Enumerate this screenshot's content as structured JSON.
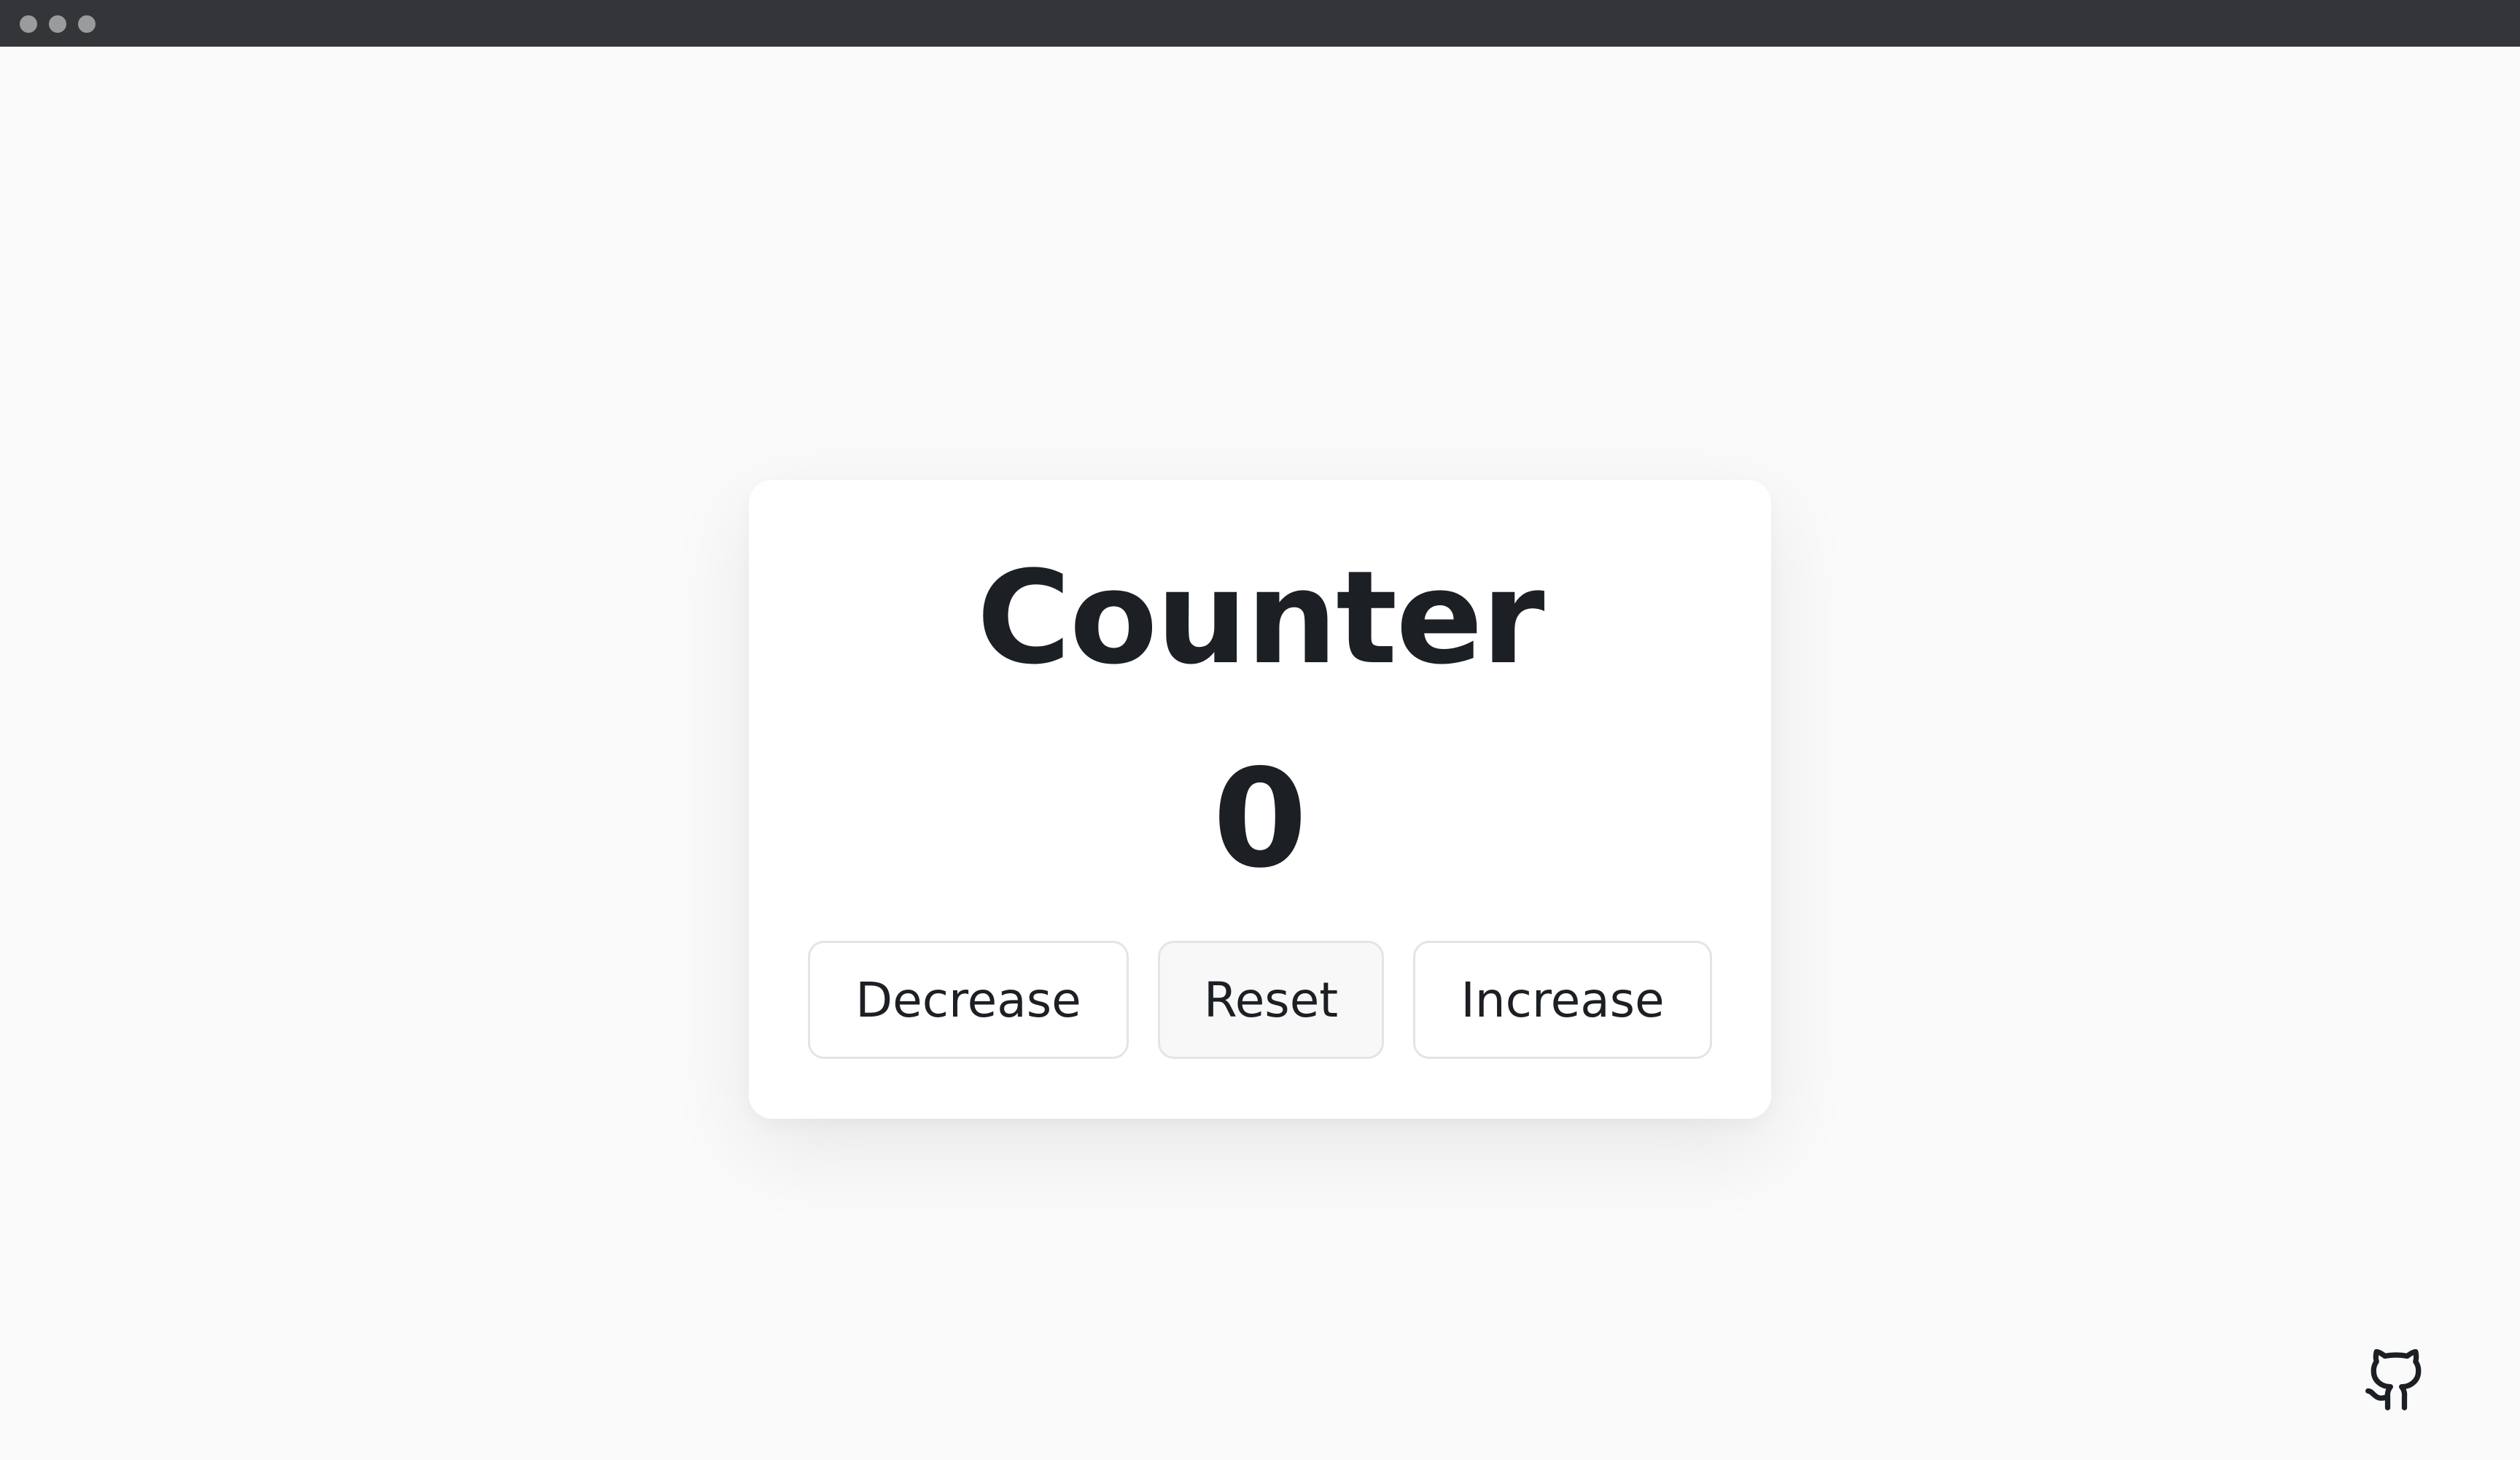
{
  "window": {
    "controls": [
      "close",
      "minimize",
      "maximize"
    ]
  },
  "counter": {
    "title": "Counter",
    "value": 0,
    "buttons": {
      "decrease": "Decrease",
      "reset": "Reset",
      "increase": "Increase"
    }
  },
  "footer": {
    "icon": "github-icon"
  },
  "colors": {
    "background": "#fafafa",
    "titlebar": "#343538",
    "card": "#ffffff",
    "text": "#1c1f24",
    "button_border": "#e3e4e6"
  }
}
